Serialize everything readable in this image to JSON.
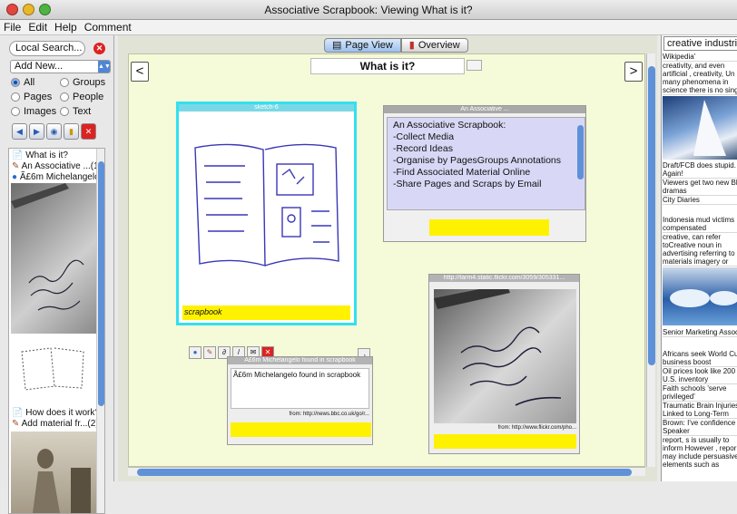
{
  "window": {
    "title": "Associative Scrapbook: Viewing What is it?"
  },
  "menu": [
    "File",
    "Edit",
    "Help",
    "Comment"
  ],
  "left": {
    "search_value": "Local Search...",
    "add_new": "Add New...",
    "filters": [
      {
        "label": "All",
        "selected": true
      },
      {
        "label": "Groups",
        "selected": false
      },
      {
        "label": "Pages",
        "selected": false
      },
      {
        "label": "People",
        "selected": false
      },
      {
        "label": "Images",
        "selected": false
      },
      {
        "label": "Text",
        "selected": false
      }
    ],
    "items": [
      "What is it?",
      "An Associative ...(1)",
      "Ã£6m Michelangelo fo...",
      "How does it work?",
      "Add material fr...(2)"
    ]
  },
  "tabs": {
    "page_view": "Page View",
    "overview": "Overview"
  },
  "page": {
    "title": "What is it?",
    "sketch": {
      "header": "sketch-6",
      "caption": "scrapbook"
    },
    "note": {
      "header": "An Associative ...",
      "lines": [
        "An Associative Scrapbook:",
        "-Collect Media",
        "-Record Ideas",
        "-Organise by PagesGroups Annotations",
        "-Find Associated Material Online",
        "-Share Pages and Scraps by Email"
      ]
    },
    "bbc": {
      "header": "Ã£6m Michelangelo found in scrapbook",
      "text": "Ã£6m Michelangelo found in scrapbook",
      "source": "from: http://news.bbc.co.uk/go/r..."
    },
    "flickr": {
      "header": "http://farm4.static.flickr.com/3059/305331...",
      "source": "from: http://www.flickr.com/pho..."
    }
  },
  "right": {
    "search_value": "creative industries",
    "items": [
      "Wikipedia'",
      "creativity, and even\nartificial , creativity, Un\nmany phenomena in\nscience there is no sing",
      "Draft/FCB does stupid.\nAgain!",
      "Viewers get two new BB\ndramas",
      "City Diaries",
      "Indonesia mud victims\ncompensated",
      "creative,  can refer\ntoCreative noun in\nadvertising referring to\nmaterials imagery or",
      "Senior Marketing Assoc",
      "Africans seek World Cu\nbusiness boost",
      "Oil prices look like 200\nU.S. inventory",
      "Faith schools 'serve\nprivileged'",
      "Traumatic Brain Injuries\nLinked to Long-Term",
      "Brown: I've confidence i\nSpeaker",
      "report, s is usually to\ninform However , repor\nmay include persuasive\nelements such as"
    ]
  }
}
